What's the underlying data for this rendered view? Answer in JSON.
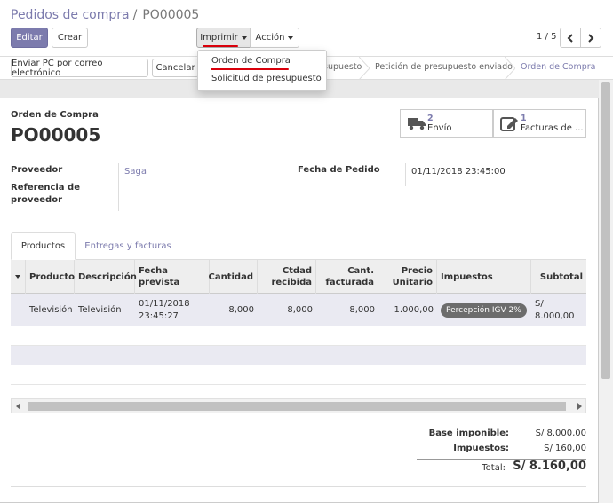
{
  "breadcrumb": {
    "parent": "Pedidos de compra",
    "separator": "/",
    "current": "PO00005"
  },
  "toolbar": {
    "edit": "Editar",
    "create": "Crear",
    "print": "Imprimir",
    "action": "Acción"
  },
  "pager": {
    "value": "1 / 5"
  },
  "actions": {
    "send_email": "Enviar PC por correo electrónico",
    "cancel": "Cancelar"
  },
  "statusbar": {
    "stages": [
      {
        "label": "supuesto"
      },
      {
        "label": "Petición de presupuesto enviado"
      },
      {
        "label": "Orden de Compra"
      }
    ],
    "active_index": 2
  },
  "print_menu": {
    "items": [
      "Orden de Compra",
      "Solicitud de presupuesto"
    ]
  },
  "form": {
    "doc_type": "Orden de Compra",
    "doc_name": "PO00005",
    "smart_buttons": [
      {
        "count": "2",
        "label": "Envío",
        "icon": "truck-icon"
      },
      {
        "count": "1",
        "label": "Facturas de ...",
        "icon": "edit-icon"
      }
    ],
    "fields": {
      "vendor_label": "Proveedor",
      "vendor_value": "Saga",
      "vendor_ref_label_1": "Referencia de",
      "vendor_ref_label_2": "proveedor",
      "order_date_label": "Fecha de Pedido",
      "order_date_value": "01/11/2018 23:45:00"
    }
  },
  "tabs": [
    "Productos",
    "Entregas y facturas"
  ],
  "table": {
    "headers": {
      "producto": "Producto",
      "descripcion": "Descripción",
      "fecha_1": "Fecha prevista",
      "cantidad": "Cantidad",
      "ctdad_1": "Ctdad",
      "ctdad_2": "recibida",
      "cant_1": "Cant.",
      "cant_2": "facturada",
      "precio_1": "Precio",
      "precio_2": "Unitario",
      "impuestos": "Impuestos",
      "subtotal": "Subtotal"
    },
    "row": {
      "producto": "Televisión",
      "descripcion": "Televisión",
      "fecha_1": "01/11/2018",
      "fecha_2": "23:45:27",
      "cantidad": "8,000",
      "recibida": "8,000",
      "facturada": "8,000",
      "precio": "1.000,00",
      "impuesto_tag": "Percepción IGV 2%",
      "subtotal": "S/ 8.000,00"
    }
  },
  "totals": {
    "base_label": "Base imponible:",
    "base_value": "S/ 8.000,00",
    "tax_label": "Impuestos:",
    "tax_value": "S/ 160,00",
    "total_label": "Total:",
    "total_value": "S/ 8.160,00"
  },
  "colors": {
    "accent": "#7c7bad",
    "underline": "#d9000b",
    "tag": "#6c6c6c"
  }
}
